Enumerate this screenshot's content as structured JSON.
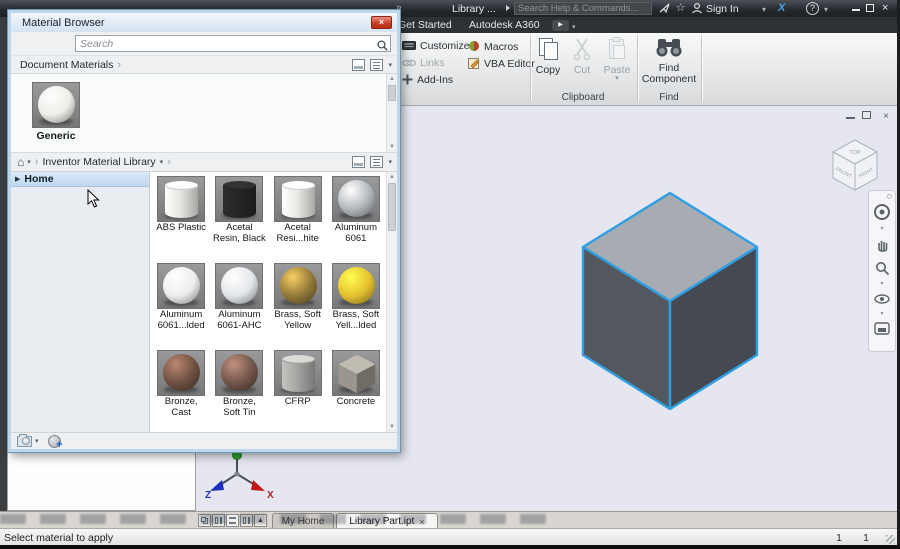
{
  "icons": {
    "overflow": "»",
    "caret_down": "▾",
    "chevron": "›",
    "home": "⌂",
    "star": "☆",
    "play": "▶",
    "tree_expand": "▶",
    "scroll_up": "▲",
    "scroll_down": "▼",
    "arrange_up": "▲",
    "close": "×",
    "question": "?",
    "exchange": "X"
  },
  "titlebar": {
    "title": "Library ...",
    "search_placeholder": "Search Help & Commands...",
    "sign_in": "Sign In"
  },
  "ribbon": {
    "tabs": [
      {
        "label": "Get Started"
      },
      {
        "label": "Autodesk A360"
      }
    ],
    "tools": {
      "customize": "Customize",
      "links": "Links",
      "addins": "Add-Ins",
      "macros": "Macros",
      "vba_editor": "VBA Editor"
    },
    "clipboard": {
      "group_label": "Clipboard",
      "copy": "Copy",
      "cut": "Cut",
      "paste": "Paste"
    },
    "find": {
      "group_label": "Find",
      "find_component": "Find\nComponent"
    }
  },
  "dialog": {
    "title": "Material Browser",
    "search_placeholder": "Search",
    "document_materials": {
      "header": "Document Materials",
      "items": [
        {
          "label": "Generic",
          "shape": "sphere",
          "color": "#efedе9"
        }
      ]
    },
    "library": {
      "breadcrumb": "Inventor Material Library",
      "home_item": "Home"
    },
    "materials": [
      {
        "label": "ABS Plastic",
        "shape": "cylinder",
        "color": "#e9e7e3"
      },
      {
        "label": "Acetal\nResin, Black",
        "shape": "cylinder",
        "color": "#262626"
      },
      {
        "label": "Acetal\nResi...hite",
        "shape": "cylinder",
        "color": "#eceae6"
      },
      {
        "label": "Aluminum\n6061",
        "shape": "sphere",
        "color": "#b4b8bd"
      },
      {
        "label": "Aluminum\n6061...lded",
        "shape": "sphere",
        "color": "#ebedef"
      },
      {
        "label": "Aluminum\n6061-AHC",
        "shape": "sphere",
        "color": "#e3e6e9"
      },
      {
        "label": "Brass, Soft\nYellow",
        "shape": "sphere",
        "color": "#92793a"
      },
      {
        "label": "Brass, Soft\nYell...lded",
        "shape": "sphere",
        "color": "#e4c02f"
      },
      {
        "label": "Bronze,\nCast",
        "shape": "sphere",
        "color": "#6e5042"
      },
      {
        "label": "Bronze,\nSoft Tin",
        "shape": "sphere",
        "color": "#72554a"
      },
      {
        "label": "CFRP",
        "shape": "cylinder",
        "color": "#a5a5a3"
      },
      {
        "label": "Concrete",
        "shape": "cube",
        "color": "#9a968e"
      }
    ]
  },
  "viewport": {
    "viewcube": {
      "top": "TOP",
      "front": "FRONT",
      "right": "RIGHT"
    },
    "axes": {
      "x": "X",
      "z": "Z"
    },
    "cube": {
      "top": "#a7abb2",
      "left": "#53585f",
      "right": "#454a52",
      "edge": "#2e9fe3"
    }
  },
  "bottombar": {
    "tabs": [
      {
        "label": "My Home"
      },
      {
        "label": "Library Part.ipt"
      }
    ]
  },
  "statusbar": {
    "message": "Select material to apply",
    "counter1": "1",
    "counter2": "1"
  }
}
